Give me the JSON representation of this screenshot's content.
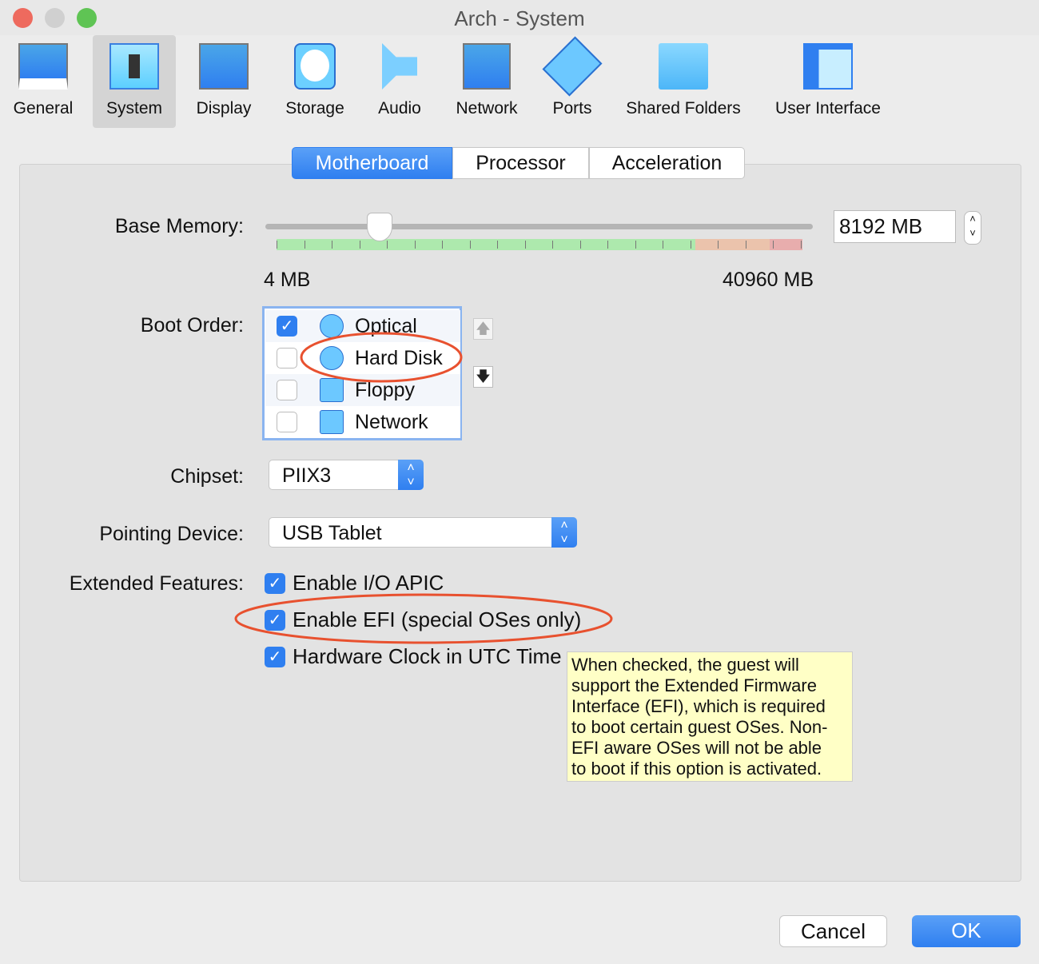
{
  "window": {
    "title": "Arch - System"
  },
  "toolbar": [
    {
      "label": "General",
      "icon": "monitor-icon"
    },
    {
      "label": "System",
      "icon": "chip-icon",
      "selected": true
    },
    {
      "label": "Display",
      "icon": "display-icon"
    },
    {
      "label": "Storage",
      "icon": "disk-icon"
    },
    {
      "label": "Audio",
      "icon": "speaker-icon"
    },
    {
      "label": "Network",
      "icon": "network-icon"
    },
    {
      "label": "Ports",
      "icon": "ports-icon"
    },
    {
      "label": "Shared Folders",
      "icon": "folder-icon"
    },
    {
      "label": "User Interface",
      "icon": "window-icon"
    }
  ],
  "tabs": [
    {
      "label": "Motherboard",
      "selected": true
    },
    {
      "label": "Processor"
    },
    {
      "label": "Acceleration"
    }
  ],
  "memory": {
    "label": "Base Memory:",
    "value": 8192,
    "value_text": "8192 MB",
    "min_label": "4 MB",
    "max_label": "40960 MB",
    "min": 4,
    "max": 40960
  },
  "boot": {
    "label": "Boot Order:",
    "items": [
      {
        "label": "Optical",
        "checked": true
      },
      {
        "label": "Hard Disk",
        "checked": false
      },
      {
        "label": "Floppy",
        "checked": false
      },
      {
        "label": "Network",
        "checked": false
      }
    ]
  },
  "chipset": {
    "label": "Chipset:",
    "value": "PIIX3"
  },
  "pointing": {
    "label": "Pointing Device:",
    "value": "USB Tablet"
  },
  "features": {
    "label": "Extended Features:",
    "items": [
      {
        "label": "Enable I/O APIC",
        "checked": true
      },
      {
        "label": "Enable EFI (special OSes only)",
        "checked": true
      },
      {
        "label": "Hardware Clock in UTC Time",
        "checked": true
      }
    ]
  },
  "tooltip": "When checked, the guest will\nsupport the Extended Firmware\nInterface (EFI), which is required\nto boot certain guest OSes. Non-\nEFI aware OSes will not be able\nto boot if this option is activated.",
  "buttons": {
    "cancel": "Cancel",
    "ok": "OK"
  },
  "colors": {
    "accent": "#2f7ff0",
    "annotation": "#e8512f",
    "tooltip_bg": "#ffffc6"
  }
}
